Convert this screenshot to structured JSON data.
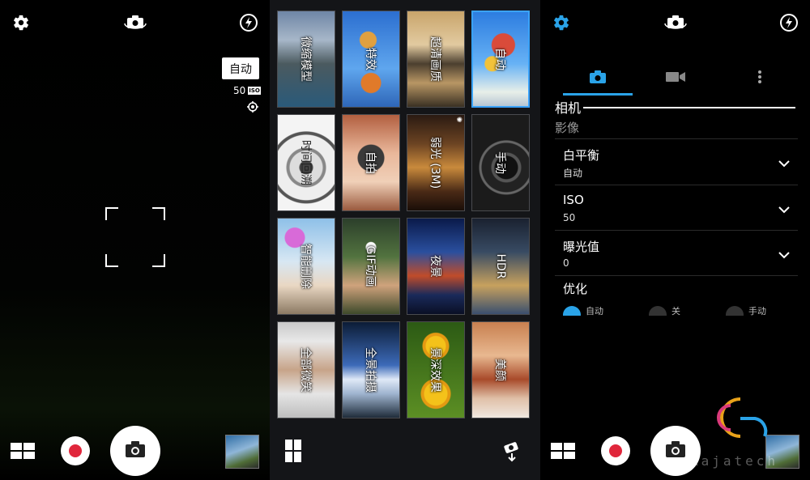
{
  "left_panel": {
    "icons": [
      "gear-icon",
      "switch-camera-icon",
      "flash-auto-icon",
      "focus-target-icon",
      "mode-grid-icon",
      "camera-icon"
    ],
    "mode_badge": "自动",
    "iso_value": "50",
    "iso_tag": "ISO"
  },
  "mode_grid": {
    "tiles": [
      {
        "label": "微缩模型"
      },
      {
        "label": "特效"
      },
      {
        "label": "超清画质"
      },
      {
        "label": "自动"
      },
      {
        "label": "时间回溯"
      },
      {
        "label": "自拍"
      },
      {
        "label": "弱光 (3M)"
      },
      {
        "label": "手动"
      },
      {
        "label": "智能删除"
      },
      {
        "label": "GIF动画"
      },
      {
        "label": "夜景"
      },
      {
        "label": "HDR"
      },
      {
        "label": "全部微笑"
      },
      {
        "label": "全景拍摄"
      },
      {
        "label": "景深效果"
      },
      {
        "label": "美颜"
      }
    ],
    "selected_index": 3
  },
  "settings_panel": {
    "accent_color": "#2aa3e8",
    "tabs": [
      "camera-tab",
      "video-tab",
      "more-tab"
    ],
    "section_title": "相机",
    "section_subtitle": "影像",
    "settings": [
      {
        "name": "白平衡",
        "value": "自动"
      },
      {
        "name": "ISO",
        "value": "50"
      },
      {
        "name": "曝光值",
        "value": "0"
      }
    ],
    "optimize_title": "优化",
    "optimize_options": [
      "自动",
      "关",
      "手动"
    ],
    "optimize_selected": 0
  },
  "watermark": "Rajatech"
}
